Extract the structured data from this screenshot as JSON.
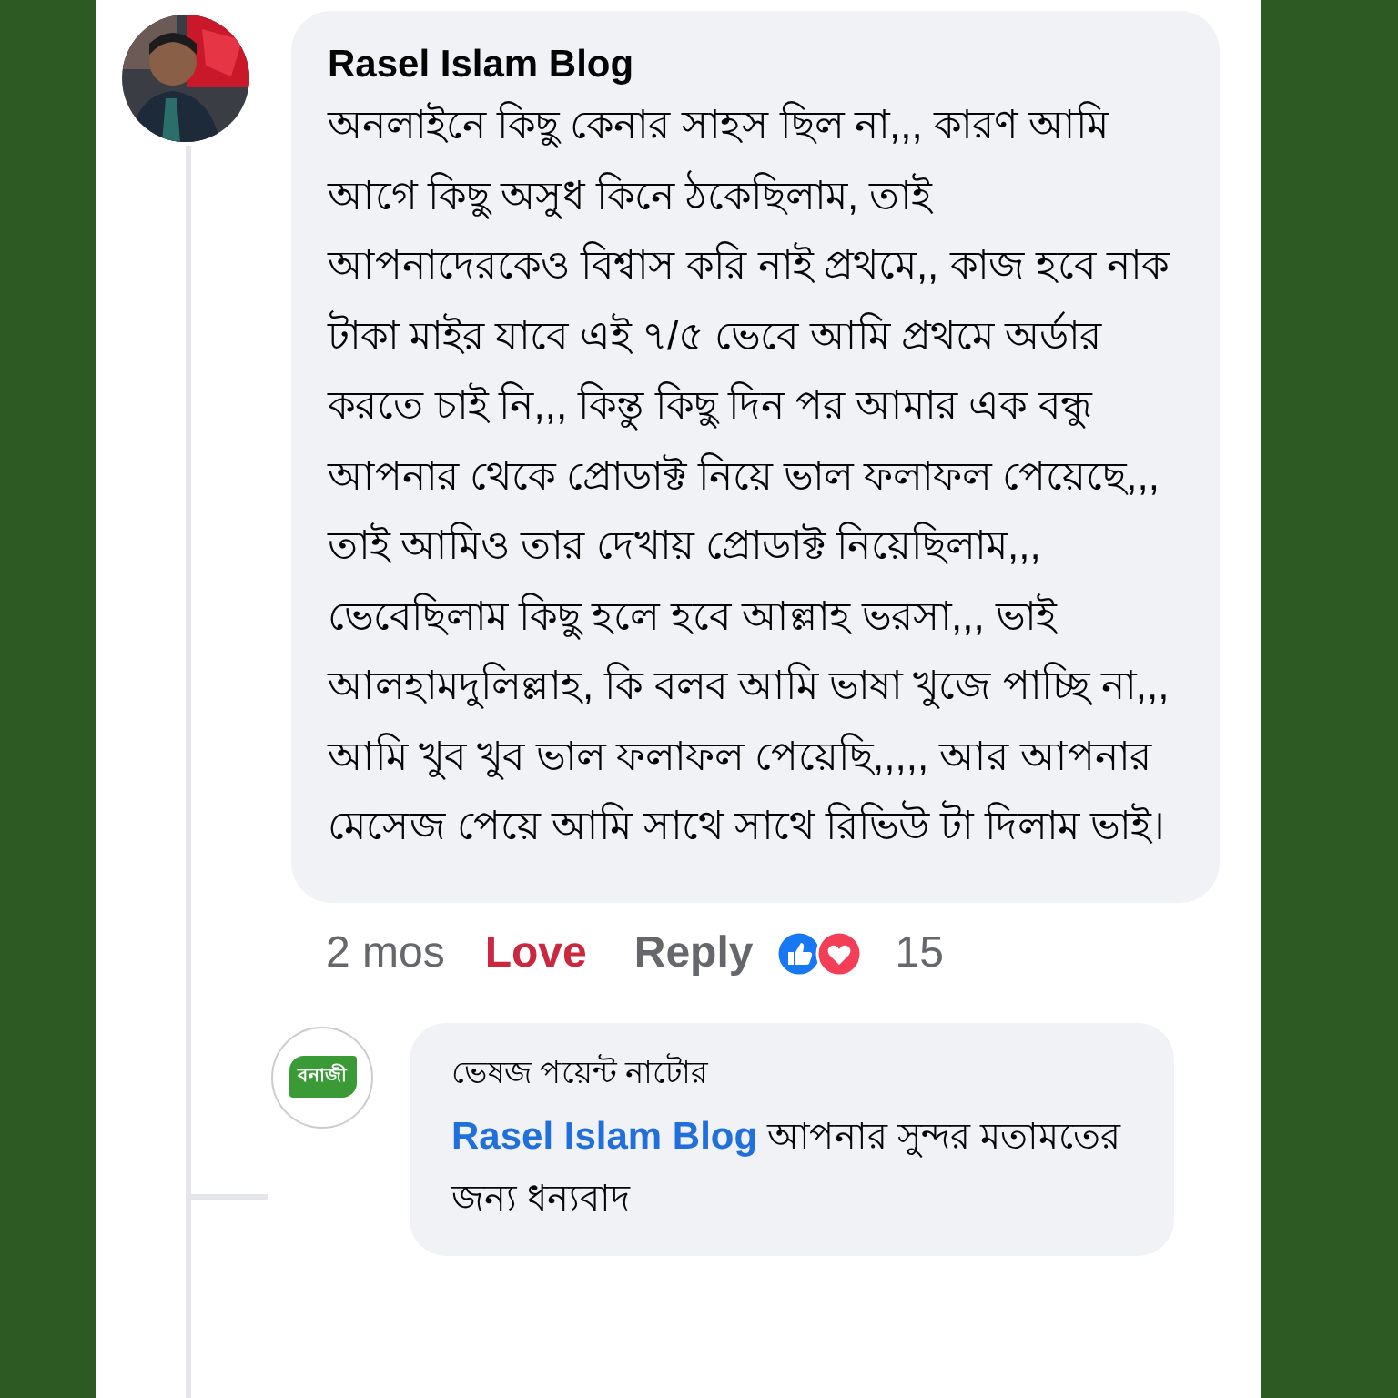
{
  "comment": {
    "author": "Rasel Islam Blog",
    "text": "অনলাইনে কিছু কেনার সাহস ছিল না,,, কারণ আমি আগে কিছু অসুধ কিনে ঠকেছিলাম, তাই আপনাদেরকেও বিশ্বাস করি নাই প্রথমে,, কাজ হবে নাক টাকা মাইর যাবে এই ৭/৫ ভেবে আমি প্রথমে অর্ডার করতে চাই নি,,, কিন্তু কিছু দিন পর আমার এক বন্ধু আপনার থেকে প্রোডাক্ট নিয়ে ভাল ফলাফল পেয়েছে,,, তাই আমিও তার দেখায় প্রোডাক্ট নিয়েছিলাম,,, ভেবেছিলাম কিছু হলে হবে আল্লাহ ভরসা,,, ভাই আলহামদুলিল্লাহ, কি বলব আমি ভাষা খুজে পাচ্ছি না,,, আমি খুব খুব ভাল ফলাফল পেয়েছি,,,,, আর আপনার মেসেজ পেয়ে আমি সাথে সাথে রিভিউ টা দিলাম ভাই।",
    "time": "2 mos",
    "reaction_label": "Love",
    "reply_label": "Reply",
    "reaction_count": "15"
  },
  "reply": {
    "logo_text": "বনাজী",
    "author": "ভেষজ পয়েন্ট নাটোর",
    "mention": "Rasel Islam Blog",
    "text": "আপনার সুন্দর মতামতের জন্য ধন্যবাদ"
  }
}
